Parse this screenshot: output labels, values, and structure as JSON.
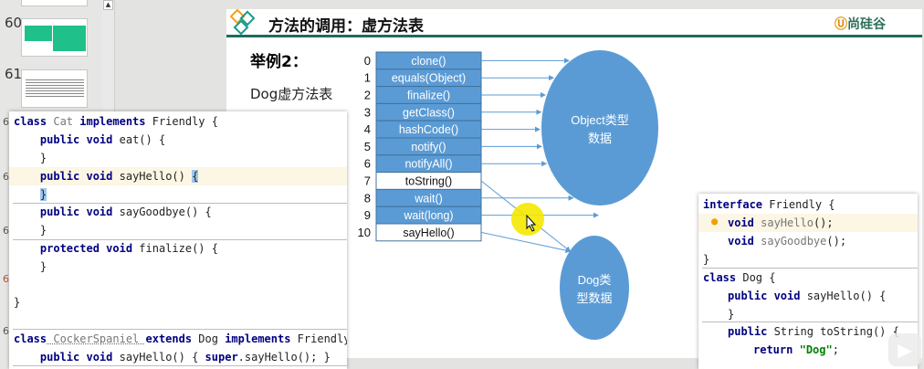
{
  "thumbnails": [
    {
      "number": "60"
    },
    {
      "number": "61"
    }
  ],
  "slide": {
    "title": "方法的调用：虚方法表",
    "brand": "尚硅谷",
    "example_label": "举例2：",
    "subtitle": "Dog虚方法表",
    "vtable": [
      {
        "index": "0",
        "method": "clone()",
        "inherited": true
      },
      {
        "index": "1",
        "method": "equals(Object)",
        "inherited": true
      },
      {
        "index": "2",
        "method": "finalize()",
        "inherited": true
      },
      {
        "index": "3",
        "method": "getClass()",
        "inherited": true
      },
      {
        "index": "4",
        "method": "hashCode()",
        "inherited": true
      },
      {
        "index": "5",
        "method": "notify()",
        "inherited": true
      },
      {
        "index": "6",
        "method": "notifyAll()",
        "inherited": true
      },
      {
        "index": "7",
        "method": "toString()",
        "inherited": false
      },
      {
        "index": "8",
        "method": "wait()",
        "inherited": true
      },
      {
        "index": "9",
        "method": "wait(long)",
        "inherited": true
      },
      {
        "index": "10",
        "method": "sayHello()",
        "inherited": false
      }
    ],
    "object_node": [
      "Object类型",
      "数据"
    ],
    "dog_node": [
      "Dog类",
      "型数据"
    ],
    "colors": {
      "accent": "#5b9bd5",
      "header_line": "#1f6b5c",
      "cursor_highlight": "#f5e800"
    }
  },
  "cat_code": {
    "l1": [
      "class",
      " Cat ",
      "implements",
      " Friendly {"
    ],
    "l2": [
      "    ",
      "public void",
      " eat() {"
    ],
    "l3": "    }",
    "l4": [
      "    ",
      "public void",
      " sayHello() ",
      "{"
    ],
    "l5": "}",
    "l6": [
      "    ",
      "public void",
      " sayGoodbye() {"
    ],
    "l7": "    }",
    "l8": [
      "    ",
      "protected void",
      " finalize() {"
    ],
    "l9": "    }",
    "l10": "}",
    "l11": [
      "class",
      " CockerSpaniel ",
      "extends",
      " Dog ",
      "implements",
      " Friendly {"
    ],
    "l12": [
      "    ",
      "public void",
      " sayHello() { ",
      "super",
      ".sayHello(); }"
    ]
  },
  "friendly_code": {
    "l1": [
      "interface",
      " Friendly {"
    ],
    "l2": [
      "void",
      " sayHello",
      "();"
    ],
    "l3": [
      "void",
      " sayGoodbye",
      "();"
    ],
    "l4": "}",
    "l5": [
      "class",
      " Dog {"
    ],
    "l6": [
      "public void",
      " sayHello() {"
    ],
    "l7": "}",
    "l8": [
      "public",
      " String toString() {"
    ],
    "l9": [
      "return",
      " ",
      "\"Dog\"",
      ";"
    ]
  },
  "gutter": "6"
}
